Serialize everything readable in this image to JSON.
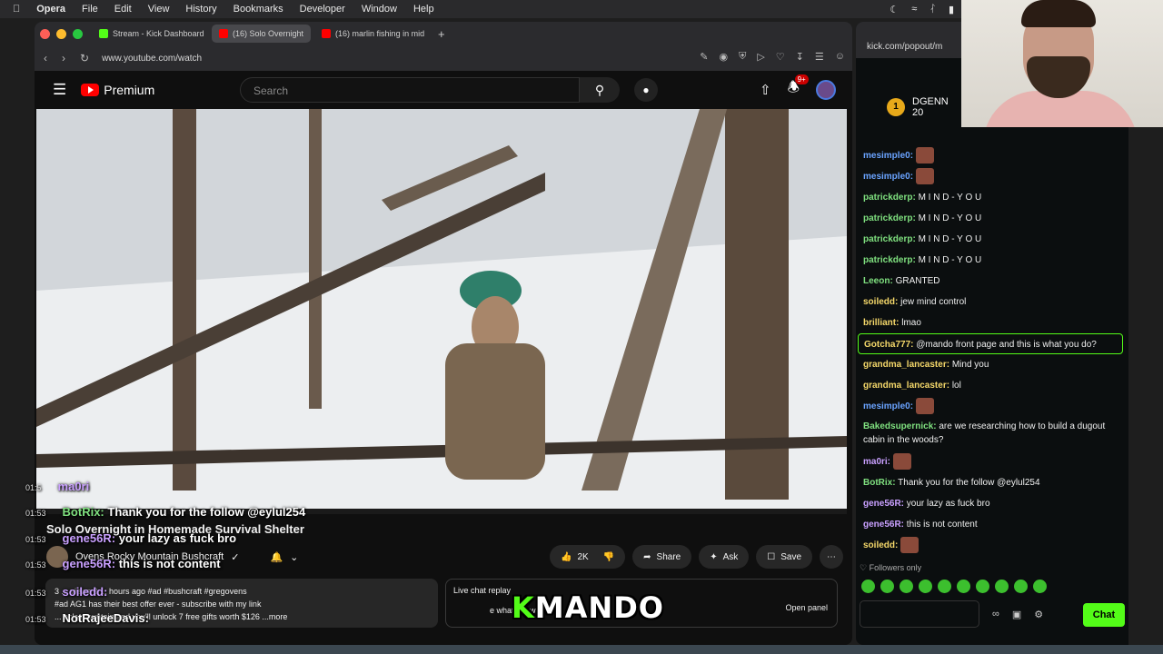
{
  "menubar": {
    "items": [
      "Opera",
      "File",
      "Edit",
      "View",
      "History",
      "Bookmarks",
      "Developer",
      "Window",
      "Help"
    ]
  },
  "browser": {
    "tabs": [
      {
        "label": "Stream - Kick Dashboard",
        "color": "#53fc18"
      },
      {
        "label": "(16) Solo Overnight",
        "color": "#ff0000"
      },
      {
        "label": "(16) marlin fishing in mid",
        "color": "#ff0000"
      }
    ],
    "url": "www.youtube.com/watch"
  },
  "youtube": {
    "logo": "Premium",
    "search_placeholder": "Search",
    "notif_count": "9+",
    "video_title": "Solo Overnight in Homemade Survival Shelter",
    "channel": "Ovens Rocky Mountain Bushcraft",
    "likes": "2K",
    "share": "Share",
    "ask": "Ask",
    "save": "Save",
    "desc_line1": "3 ... views 3 ... hours ago  #ad #bushcraft #gregovens",
    "desc_line2": "#ad AG1 has their best offer ever - subscribe with my link",
    "desc_line3": "... ockymountain and you'll unlock 7 free gifts worth $126 ...more",
    "livechat_title": "Live chat replay",
    "livechat_text": "e what ... t was live.",
    "open_panel": "Open panel"
  },
  "overlay": {
    "lines": [
      {
        "ts": "01:5",
        "name": "ma0ri",
        "text": ""
      },
      {
        "ts": "01:53",
        "name": "BotRix:",
        "text": "Thank you for the follow @eylul254"
      },
      {
        "ts": "01:53",
        "name": "gene56R:",
        "text": "your lazy as fuck bro"
      },
      {
        "ts": "01:53",
        "name": "gene56R:",
        "text": "this is not content"
      },
      {
        "ts": "01:53",
        "name": "soiledd:",
        "text": ""
      },
      {
        "ts": "01:53",
        "name": "NotRajeeDavis:",
        "text": ""
      }
    ],
    "logo_k": "K",
    "logo_rest": "MANDO"
  },
  "kick": {
    "url": "kick.com/popout/m",
    "pinned_name": "DGENN",
    "pinned_count": "20",
    "pinned_rank": "1",
    "messages": [
      {
        "user": "mesimple0:",
        "text": "",
        "color": "#6aa3ff",
        "emote": true
      },
      {
        "user": "mesimple0:",
        "text": "",
        "color": "#6aa3ff",
        "emote": true
      },
      {
        "user": "patrickderp:",
        "text": "M I N D - Y O U",
        "color": "#7fe07f"
      },
      {
        "user": "patrickderp:",
        "text": "M I N D - Y O U",
        "color": "#7fe07f"
      },
      {
        "user": "patrickderp:",
        "text": "M I N D - Y O U",
        "color": "#7fe07f"
      },
      {
        "user": "patrickderp:",
        "text": "M I N D - Y O U",
        "color": "#7fe07f"
      },
      {
        "user": "Leeon:",
        "text": "GRANTED",
        "color": "#7fe07f"
      },
      {
        "user": "soiledd:",
        "text": "jew mind control",
        "color": "#f5d86a"
      },
      {
        "user": "brilliant:",
        "text": "lmao",
        "color": "#f5d86a"
      },
      {
        "user": "Gotcha777:",
        "text": "@mando front page and this is what you do?",
        "color": "#f5d86a",
        "highlight": true
      },
      {
        "user": "grandma_lancaster:",
        "text": "Mind you",
        "color": "#f5d86a"
      },
      {
        "user": "grandma_lancaster:",
        "text": "lol",
        "color": "#f5d86a"
      },
      {
        "user": "mesimple0:",
        "text": "",
        "color": "#6aa3ff",
        "emote": true
      },
      {
        "user": "Bakedsupernick:",
        "text": "are we researching how to build a dugout cabin in the woods?",
        "color": "#7fe07f",
        "two": true
      },
      {
        "user": "ma0ri:",
        "text": "",
        "color": "#c9a0ff",
        "emote": true
      },
      {
        "user": "BotRix:",
        "text": "Thank you for the follow @eylul254",
        "color": "#7fe07f"
      },
      {
        "user": "gene56R:",
        "text": "your lazy as fuck bro",
        "color": "#c9a0ff"
      },
      {
        "user": "gene56R:",
        "text": "this is not content",
        "color": "#c9a0ff"
      },
      {
        "user": "soiledd:",
        "text": "",
        "color": "#f5d86a",
        "emote": true
      }
    ],
    "followers_only": "Followers only",
    "chat_button": "Chat"
  }
}
